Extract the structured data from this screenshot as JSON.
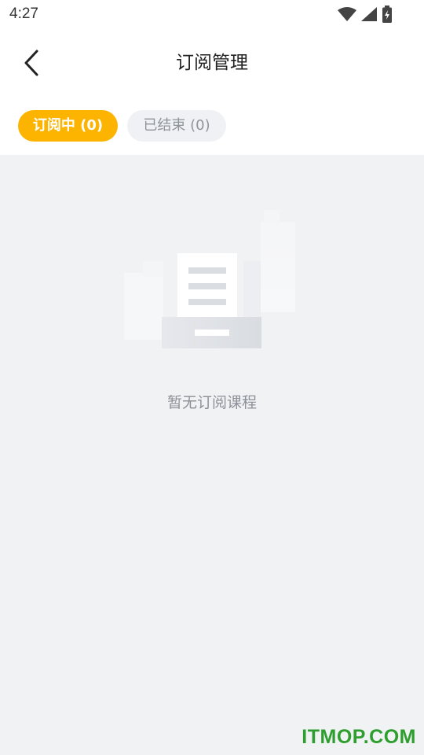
{
  "status_bar": {
    "time": "4:27",
    "icons": [
      "wifi-icon",
      "signal-icon",
      "battery-icon"
    ]
  },
  "header": {
    "title": "订阅管理",
    "back_icon": "chevron-left-icon"
  },
  "tabs": [
    {
      "label": "订阅中 (0)",
      "active": true
    },
    {
      "label": "已结束 (0)",
      "active": false
    }
  ],
  "empty_state": {
    "message": "暂无订阅课程",
    "icon": "empty-document-icon"
  },
  "watermark": {
    "text": "ITMOP.COM"
  },
  "colors": {
    "accent": "#fdb400",
    "content_background": "#f1f2f4",
    "inactive_tab_background": "#eff1f4",
    "watermark": "#2e9e2e"
  }
}
